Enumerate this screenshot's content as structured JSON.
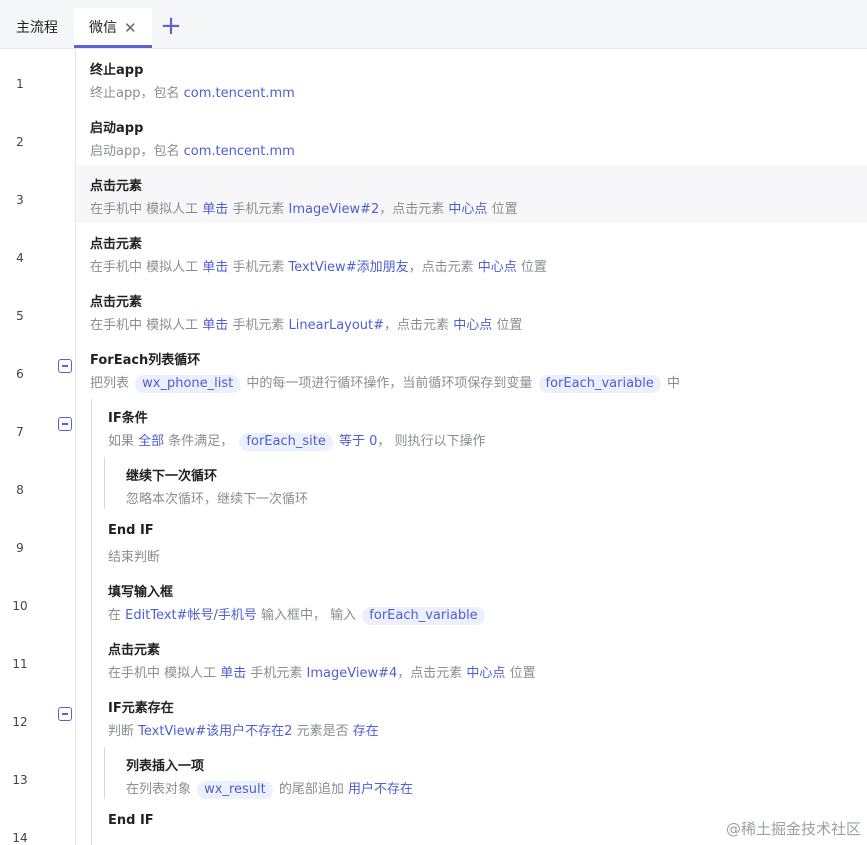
{
  "tabs": {
    "main_label": "主流程",
    "active_label": "微信",
    "close_glyph": "✕",
    "add_glyph": "+"
  },
  "accent_color": "#5b63d3",
  "rows": [
    {
      "n": "1",
      "title": "终止app",
      "d": [
        {
          "t": "终止app，包名 "
        },
        {
          "t": "com.tencent.mm",
          "k": 1
        }
      ]
    },
    {
      "n": "2",
      "title": "启动app",
      "d": [
        {
          "t": "启动app，包名 "
        },
        {
          "t": "com.tencent.mm",
          "k": 1
        }
      ]
    },
    {
      "n": "3",
      "title": "点击元素",
      "d": [
        {
          "t": "在手机中 模拟人工 "
        },
        {
          "t": "单击",
          "k": 1
        },
        {
          "t": " 手机元素 "
        },
        {
          "t": "ImageView#2",
          "k": 1
        },
        {
          "t": "，点击元素 "
        },
        {
          "t": "中心点",
          "k": 1
        },
        {
          "t": " 位置"
        }
      ]
    },
    {
      "n": "4",
      "title": "点击元素",
      "d": [
        {
          "t": "在手机中 模拟人工 "
        },
        {
          "t": "单击",
          "k": 1
        },
        {
          "t": " 手机元素 "
        },
        {
          "t": "TextView#添加朋友",
          "k": 1
        },
        {
          "t": "，点击元素 "
        },
        {
          "t": "中心点",
          "k": 1
        },
        {
          "t": " 位置"
        }
      ]
    },
    {
      "n": "5",
      "title": "点击元素",
      "d": [
        {
          "t": "在手机中 模拟人工 "
        },
        {
          "t": "单击",
          "k": 1
        },
        {
          "t": " 手机元素 "
        },
        {
          "t": "LinearLayout#",
          "k": 1
        },
        {
          "t": "，点击元素 "
        },
        {
          "t": "中心点",
          "k": 1
        },
        {
          "t": " 位置"
        }
      ]
    },
    {
      "n": "6",
      "title": "ForEach列表循环",
      "d": [
        {
          "t": "把列表 "
        },
        {
          "t": "wx_phone_list",
          "c": 1
        },
        {
          "t": " 中的每一项进行循环操作，当前循环项保存到变量 "
        },
        {
          "t": "forEach_variable",
          "c": 1
        },
        {
          "t": " 中"
        }
      ]
    },
    {
      "n": "7",
      "title": "IF条件",
      "d": [
        {
          "t": "如果 "
        },
        {
          "t": "全部",
          "k": 1
        },
        {
          "t": " 条件满足， "
        },
        {
          "t": "forEach_site",
          "c": 1
        },
        {
          "t": " "
        },
        {
          "t": "等于",
          "k": 1
        },
        {
          "t": " "
        },
        {
          "t": "0",
          "k": 1
        },
        {
          "t": "， 则执行以下操作"
        }
      ]
    },
    {
      "n": "8",
      "title": "继续下一次循环",
      "d": [
        {
          "t": "忽略本次循环，继续下一次循环"
        }
      ]
    },
    {
      "n": "9",
      "title": "End IF",
      "d": [
        {
          "t": "结束判断"
        }
      ]
    },
    {
      "n": "10",
      "title": "填写输入框",
      "d": [
        {
          "t": "在 "
        },
        {
          "t": "EditText#帐号/手机号",
          "k": 1
        },
        {
          "t": " 输入框中， 输入 "
        },
        {
          "t": "forEach_variable",
          "c": 1
        }
      ]
    },
    {
      "n": "11",
      "title": "点击元素",
      "d": [
        {
          "t": "在手机中 模拟人工 "
        },
        {
          "t": "单击",
          "k": 1
        },
        {
          "t": " 手机元素 "
        },
        {
          "t": "ImageView#4",
          "k": 1
        },
        {
          "t": "，点击元素 "
        },
        {
          "t": "中心点",
          "k": 1
        },
        {
          "t": " 位置"
        }
      ]
    },
    {
      "n": "12",
      "title": "IF元素存在",
      "d": [
        {
          "t": "判断 "
        },
        {
          "t": "TextView#该用户不存在2",
          "k": 1
        },
        {
          "t": " 元素是否 "
        },
        {
          "t": "存在",
          "k": 1
        }
      ]
    },
    {
      "n": "13",
      "title": "列表插入一项",
      "d": [
        {
          "t": "在列表对象 "
        },
        {
          "t": "wx_result",
          "c": 1
        },
        {
          "t": " 的尾部追加 "
        },
        {
          "t": "用户不存在",
          "k": 1
        }
      ]
    },
    {
      "n": "14",
      "title": "End IF",
      "d": []
    }
  ],
  "watermark": "@稀土掘金技术社区"
}
